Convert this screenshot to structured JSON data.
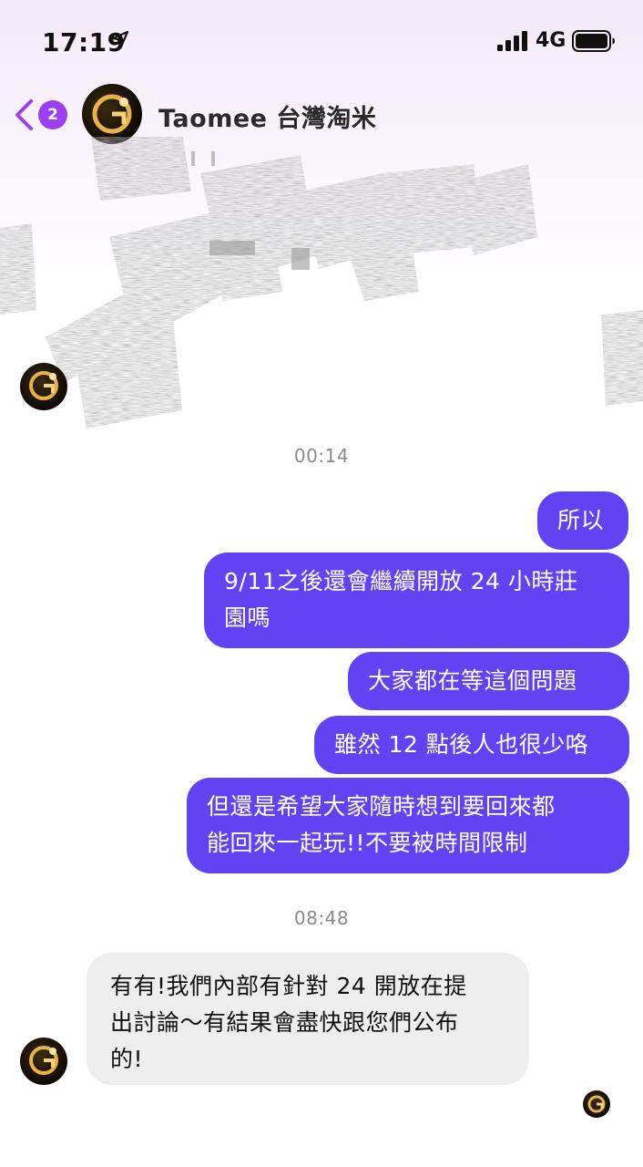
{
  "status_bar": {
    "time": "17:19",
    "network": "4G",
    "icons": [
      "location-arrow-icon",
      "signal-bars-icon",
      "battery-icon"
    ]
  },
  "header": {
    "unread_count": "2",
    "contact_name": "Taomee 台灣淘米",
    "icons": [
      "back-chevron-icon"
    ]
  },
  "messages": {
    "timestamp_1": "00:14",
    "out_1": "所以",
    "out_2": "9/11之後還會繼續開放 24 小時莊\n園嗎",
    "out_3": "大家都在等這個問題",
    "out_4": "雖然 12 點後人也很少咯",
    "out_5": "但還是希望大家隨時想到要回來都\n能回來一起玩!!不要被時間限制",
    "timestamp_2": "08:48",
    "in_1": "有有!我們內部有針對 24 開放在提\n出討論～有結果會盡快跟您們公布\n的!"
  },
  "colors": {
    "outgoing_bubble": "#6243f4",
    "incoming_bubble": "#eeeeef",
    "badge": "#9b3ff0",
    "timestamp": "#8a8a8a"
  }
}
